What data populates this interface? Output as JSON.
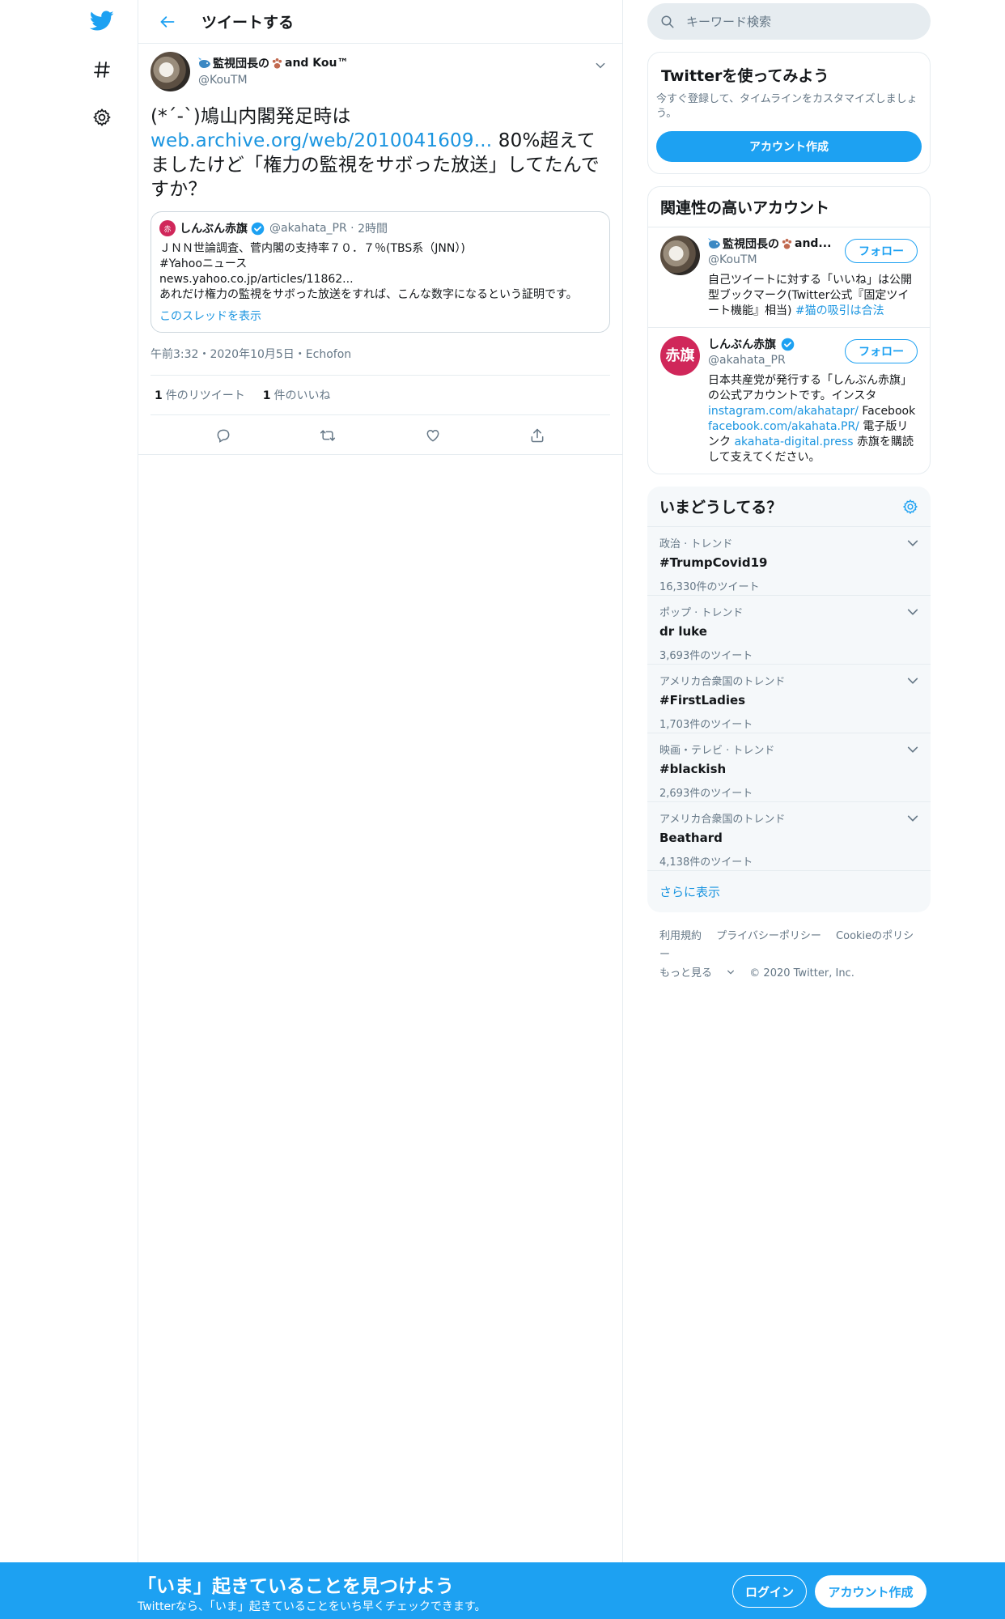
{
  "nav": {
    "logo": "twitter-bird-icon",
    "explore": "hashtag-icon",
    "settings": "gear-icon"
  },
  "header": {
    "title": "ツイートする"
  },
  "tweet": {
    "author_name": "監視団長の",
    "author_name_suffix": " and Kou™",
    "author_handle": "@KouTM",
    "text_before": "(*´-`)鳩山内閣発足時は",
    "link": "web.archive.org/web/2010041609...",
    "text_after": " 80%超えてましたけど「権力の監視をサボった放送」してたんですか？",
    "quote": {
      "name": "しんぶん赤旗",
      "handle": "@akahata_PR",
      "time": "2時間",
      "body": "ＪＮＮ世論調査、菅内閣の支持率７０．７％(TBS系（JNN）)\n#Yahooニュース\nnews.yahoo.co.jp/articles/11862...\nあれだけ権力の監視をサボった放送をすれば、こんな数字になるという証明です。",
      "thread_link": "このスレッドを表示"
    },
    "meta": "午前3:32・2020年10月5日・Echofon",
    "retweets_count": "1",
    "retweets_label": "件のリツイート",
    "likes_count": "1",
    "likes_label": "件のいいね"
  },
  "search": {
    "placeholder": "キーワード検索"
  },
  "signup_card": {
    "title": "Twitterを使ってみよう",
    "description": "今すぐ登録して、タイムラインをカスタマイズしましょう。",
    "button": "アカウント作成"
  },
  "related": {
    "title": "関連性の高いアカウント",
    "accounts": [
      {
        "name": "監視団長の",
        "name_suffix": " and...",
        "handle": "@KouTM",
        "bio_text": "自己ツイートに対する「いいね」は公開型ブックマーク(Twitter公式『固定ツイート機能』相当) ",
        "bio_link": "#猫の吸引は合法",
        "follow": "フォロー"
      },
      {
        "name": "しんぶん赤旗",
        "handle": "@akahata_PR",
        "avatar_text": "赤旗",
        "bio_1": "日本共産党が発行する「しんぶん赤旗」の公式アカウントです。インスタ ",
        "bio_link_1": "instagram.com/akahatapr/",
        "bio_2": " Facebook ",
        "bio_link_2": "facebook.com/akahata.PR/",
        "bio_3": " 電子版リンク ",
        "bio_link_3": "akahata-digital.press",
        "bio_4": " 赤旗を購読して支えてください。",
        "follow": "フォロー"
      }
    ]
  },
  "trends": {
    "title": "いまどうしてる？",
    "items": [
      {
        "context": "政治 · トレンド",
        "name": "#TrumpCovid19",
        "count": "16,330件のツイート"
      },
      {
        "context": "ポップ · トレンド",
        "name": "dr luke",
        "count": "3,693件のツイート"
      },
      {
        "context": "アメリカ合衆国のトレンド",
        "name": "#FirstLadies",
        "count": "1,703件のツイート"
      },
      {
        "context": "映画・テレビ · トレンド",
        "name": "#blackish",
        "count": "2,693件のツイート"
      },
      {
        "context": "アメリカ合衆国のトレンド",
        "name": "Beathard",
        "count": "4,138件のツイート"
      }
    ],
    "show_more": "さらに表示"
  },
  "footer": {
    "terms": "利用規約",
    "privacy": "プライバシーポリシー",
    "cookies": "Cookieのポリシー",
    "more": "もっと見る",
    "copyright": "© 2020 Twitter, Inc."
  },
  "bottom_bar": {
    "title": "「いま」起きていることを見つけよう",
    "subtitle": "Twitterなら、「いま」起きていることをいち早くチェックできます。",
    "login": "ログイン",
    "signup": "アカウント作成"
  },
  "colors": {
    "brand": "#1da1f2",
    "link": "#1b95e0",
    "secondary_text": "#657786",
    "akahata_red": "#d0275a"
  }
}
